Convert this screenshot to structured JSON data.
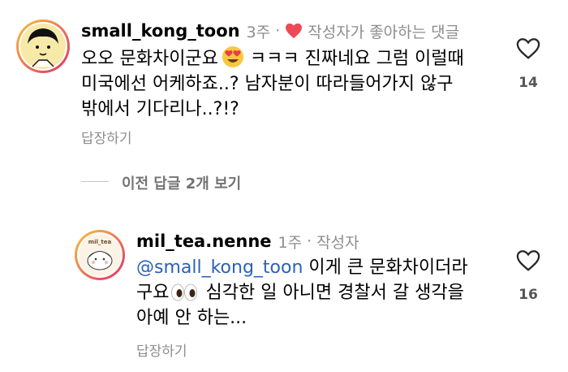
{
  "comment": {
    "username": "small_kong_toon",
    "age": "3주",
    "creator_liked_label": "작성자가 좋아하는 댓글",
    "line1_a": "오오 문화차이군요",
    "line1_b": " ㅋㅋㅋ 진짜네요 그럼 이럴때",
    "line2": "미국에선 어케하죠..? 남자분이 따라들어가지 않구",
    "line3": "밖에서 기다리나..?!?",
    "reply_label": "답장하기",
    "like_count": "14"
  },
  "view_replies_label": "이전 답글 2개 보기",
  "reply": {
    "username": "mil_tea.nenne",
    "age": "1주",
    "author_label": "작성자",
    "mention": "@small_kong_toon",
    "line1_rest": " 이게 큰 문화차이더라",
    "line2_a": "구요",
    "line2_b": " 심각한 일 아니면 경찰서 갈 생각을",
    "line3": "아예 안 하는...",
    "reply_label": "답장하기",
    "like_count": "16",
    "avatar_text": "mil_tea"
  },
  "colors": {
    "heart_red": "#ed4956",
    "mention_blue": "#2b62b6",
    "gray": "#8e8e8e"
  }
}
